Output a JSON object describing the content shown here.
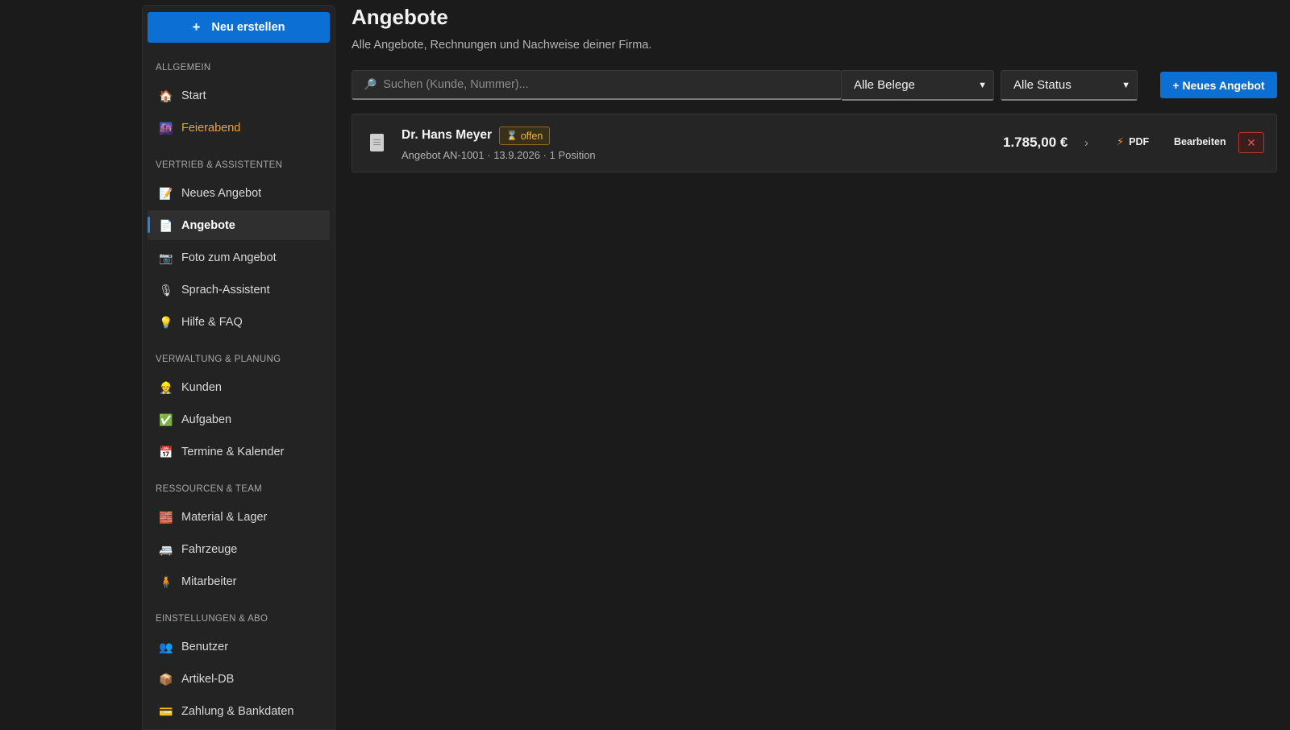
{
  "sidebar": {
    "new_button": {
      "icon": "+",
      "label": "Neu erstellen"
    },
    "sections": [
      {
        "title": "Allgemein",
        "items": [
          {
            "icon": "🏠",
            "icon_name": "house-icon",
            "label": "Start"
          },
          {
            "icon": "🌆",
            "icon_name": "evening-icon",
            "label": "Feierabend",
            "highlight": "orange"
          }
        ]
      },
      {
        "title": "Vertrieb & Assistenten",
        "items": [
          {
            "icon": "📝",
            "icon_name": "memo-icon",
            "label": "Neues Angebot"
          },
          {
            "icon": "📄",
            "icon_name": "document-icon",
            "label": "Angebote",
            "active": true
          },
          {
            "icon": "📷",
            "icon_name": "camera-icon",
            "label": "Foto zum Angebot"
          },
          {
            "icon": "🎙",
            "icon_name": "microphone-icon",
            "label": "Sprach-Assistent"
          },
          {
            "icon": "💡",
            "icon_name": "lightbulb-icon",
            "label": "Hilfe & FAQ"
          }
        ]
      },
      {
        "title": "Verwaltung & Planung",
        "items": [
          {
            "icon": "👷",
            "icon_name": "worker-icon",
            "label": "Kunden"
          },
          {
            "icon": "✅",
            "icon_name": "checkmark-icon",
            "label": "Aufgaben"
          },
          {
            "icon": "📅",
            "icon_name": "calendar-icon",
            "label": "Termine & Kalender"
          }
        ]
      },
      {
        "title": "Ressourcen & Team",
        "items": [
          {
            "icon": "🧱",
            "icon_name": "bricks-icon",
            "label": "Material & Lager"
          },
          {
            "icon": "🚐",
            "icon_name": "van-icon",
            "label": "Fahrzeuge"
          },
          {
            "icon": "🧍",
            "icon_name": "person-icon",
            "label": "Mitarbeiter"
          }
        ]
      },
      {
        "title": "Einstellungen & Abo",
        "items": [
          {
            "icon": "👥",
            "icon_name": "users-icon",
            "label": "Benutzer"
          },
          {
            "icon": "📦",
            "icon_name": "package-icon",
            "label": "Artikel-DB"
          },
          {
            "icon": "💳",
            "icon_name": "credit-card-icon",
            "label": "Zahlung & Bankdaten"
          }
        ]
      }
    ]
  },
  "main": {
    "title": "Angebote",
    "subtitle": "Alle Angebote, Rechnungen und Nachweise deiner Firma.",
    "search": {
      "icon": "🔎",
      "placeholder": "Suchen (Kunde, Nummer)..."
    },
    "filter_type": {
      "value": "Alle Belege"
    },
    "filter_status": {
      "value": "Alle Status"
    },
    "add_button": "+ Neues Angebot",
    "offers": [
      {
        "customer": "Dr. Hans Meyer",
        "status": "offen",
        "status_icon": "⌛",
        "meta": "Angebot AN-1001 · 13.9.2026 · 1 Position",
        "amount": "1.785,00 €",
        "arrow": "›",
        "pdf_label": "PDF",
        "pdf_icon": "⚡",
        "edit_label": "Bearbeiten",
        "delete_icon": "✕"
      }
    ]
  }
}
